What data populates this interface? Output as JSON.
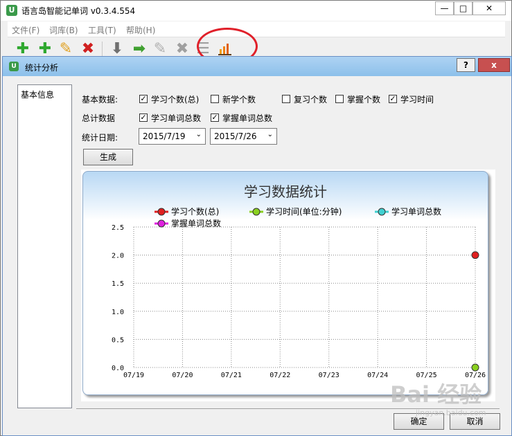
{
  "app": {
    "title": "语言岛智能记单词 v0.3.4.554",
    "logo_letter": "U",
    "menu": [
      "文件(F)",
      "词库(B)",
      "工具(T)",
      "帮助(H)"
    ],
    "toolbar_icons": [
      "plus-icon",
      "plus-icon",
      "pencil-icon",
      "delete-x-icon",
      "down-arrow-icon",
      "right-arrow-icon",
      "pencil-icon",
      "delete-x-icon",
      "stack-icon",
      "statistics-chart-icon"
    ]
  },
  "dialog": {
    "title": "统计分析",
    "help_label": "?",
    "close_label": "x",
    "side_item": "基本信息",
    "basic_label": "基本数据:",
    "total_label": "总计数据",
    "date_label": "统计日期:",
    "basic_options": [
      {
        "label": "学习个数(总)",
        "checked": true
      },
      {
        "label": "新学个数",
        "checked": false
      },
      {
        "label": "复习个数",
        "checked": false
      },
      {
        "label": "掌握个数",
        "checked": false
      },
      {
        "label": "学习时间",
        "checked": true
      }
    ],
    "total_options": [
      {
        "label": "学习单词总数",
        "checked": true
      },
      {
        "label": "掌握单词总数",
        "checked": true
      }
    ],
    "start_date": "2015/7/19",
    "end_date": "2015/7/26",
    "generate_label": "生成",
    "ok_label": "确定",
    "cancel_label": "取消"
  },
  "chart_data": {
    "type": "line",
    "title": "学习数据统计",
    "categories": [
      "07/19",
      "07/20",
      "07/21",
      "07/22",
      "07/23",
      "07/24",
      "07/25",
      "07/26"
    ],
    "ylim": [
      0,
      2.5
    ],
    "yticks": [
      "0.0",
      "0.5",
      "1.0",
      "1.5",
      "2.0",
      "2.5"
    ],
    "grid": true,
    "legend_position": "top",
    "series": [
      {
        "name": "学习个数(总)",
        "color": "#e02020",
        "points": [
          {
            "x": "07/26",
            "y": 2.0
          }
        ]
      },
      {
        "name": "学习时间(单位:分钟)",
        "color": "#8ad020",
        "points": [
          {
            "x": "07/26",
            "y": 0.0
          }
        ]
      },
      {
        "name": "学习单词总数",
        "color": "#40d0d0",
        "points": []
      },
      {
        "name": "掌握单词总数",
        "color": "#e020e0",
        "points": []
      }
    ]
  },
  "watermark": {
    "text": "Baidu 经验",
    "sub": "jingyan.baidu.com"
  },
  "colors": {
    "highlight_ellipse": "#e0202a",
    "dialog_title": "#9ccaef",
    "close_button": "#c75050"
  }
}
